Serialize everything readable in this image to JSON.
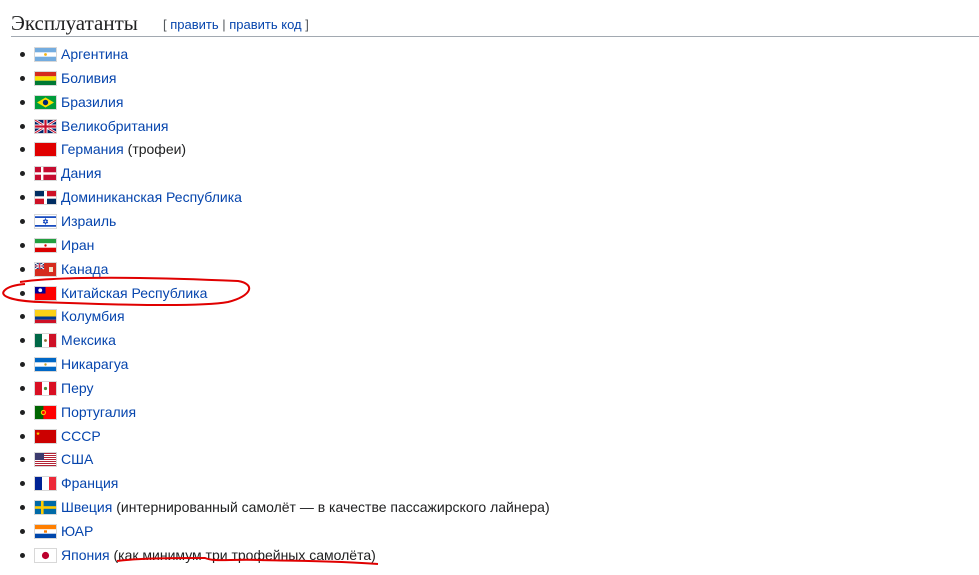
{
  "section": {
    "title": "Эксплуатанты",
    "edit_open": "[ ",
    "edit_label": "править",
    "edit_sep": " | ",
    "edit_code_label": "править код",
    "edit_close": " ]"
  },
  "countries": [
    {
      "name": "Аргентина",
      "note": "",
      "flag": "argentina"
    },
    {
      "name": "Боливия",
      "note": "",
      "flag": "bolivia"
    },
    {
      "name": "Бразилия",
      "note": "",
      "flag": "brazil"
    },
    {
      "name": "Великобритания",
      "note": "",
      "flag": "uk"
    },
    {
      "name": "Германия",
      "note": " (трофеи)",
      "flag": "germany-red"
    },
    {
      "name": "Дания",
      "note": "",
      "flag": "denmark"
    },
    {
      "name": "Доминиканская Республика",
      "note": "",
      "flag": "dominican"
    },
    {
      "name": "Израиль",
      "note": "",
      "flag": "israel"
    },
    {
      "name": "Иран",
      "note": "",
      "flag": "iran"
    },
    {
      "name": "Канада",
      "note": "",
      "flag": "canada-red-ensign"
    },
    {
      "name": "Китайская Республика",
      "note": "",
      "flag": "taiwan"
    },
    {
      "name": "Колумбия",
      "note": "",
      "flag": "colombia"
    },
    {
      "name": "Мексика",
      "note": "",
      "flag": "mexico"
    },
    {
      "name": "Никарагуа",
      "note": "",
      "flag": "nicaragua"
    },
    {
      "name": "Перу",
      "note": "",
      "flag": "peru"
    },
    {
      "name": "Португалия",
      "note": "",
      "flag": "portugal"
    },
    {
      "name": "СССР",
      "note": "",
      "flag": "ussr"
    },
    {
      "name": "США",
      "note": "",
      "flag": "usa"
    },
    {
      "name": "Франция",
      "note": "",
      "flag": "france"
    },
    {
      "name": "Швеция",
      "note": " (интернированный самолёт — в качестве пассажирского лайнера)",
      "flag": "sweden"
    },
    {
      "name": "ЮАР",
      "note": "",
      "flag": "south-africa"
    },
    {
      "name": "Япония",
      "note": " (как минимум три трофейных самолёта)",
      "flag": "japan"
    }
  ],
  "colors": {
    "link": "#0645ad",
    "annotation": "#e00000"
  }
}
